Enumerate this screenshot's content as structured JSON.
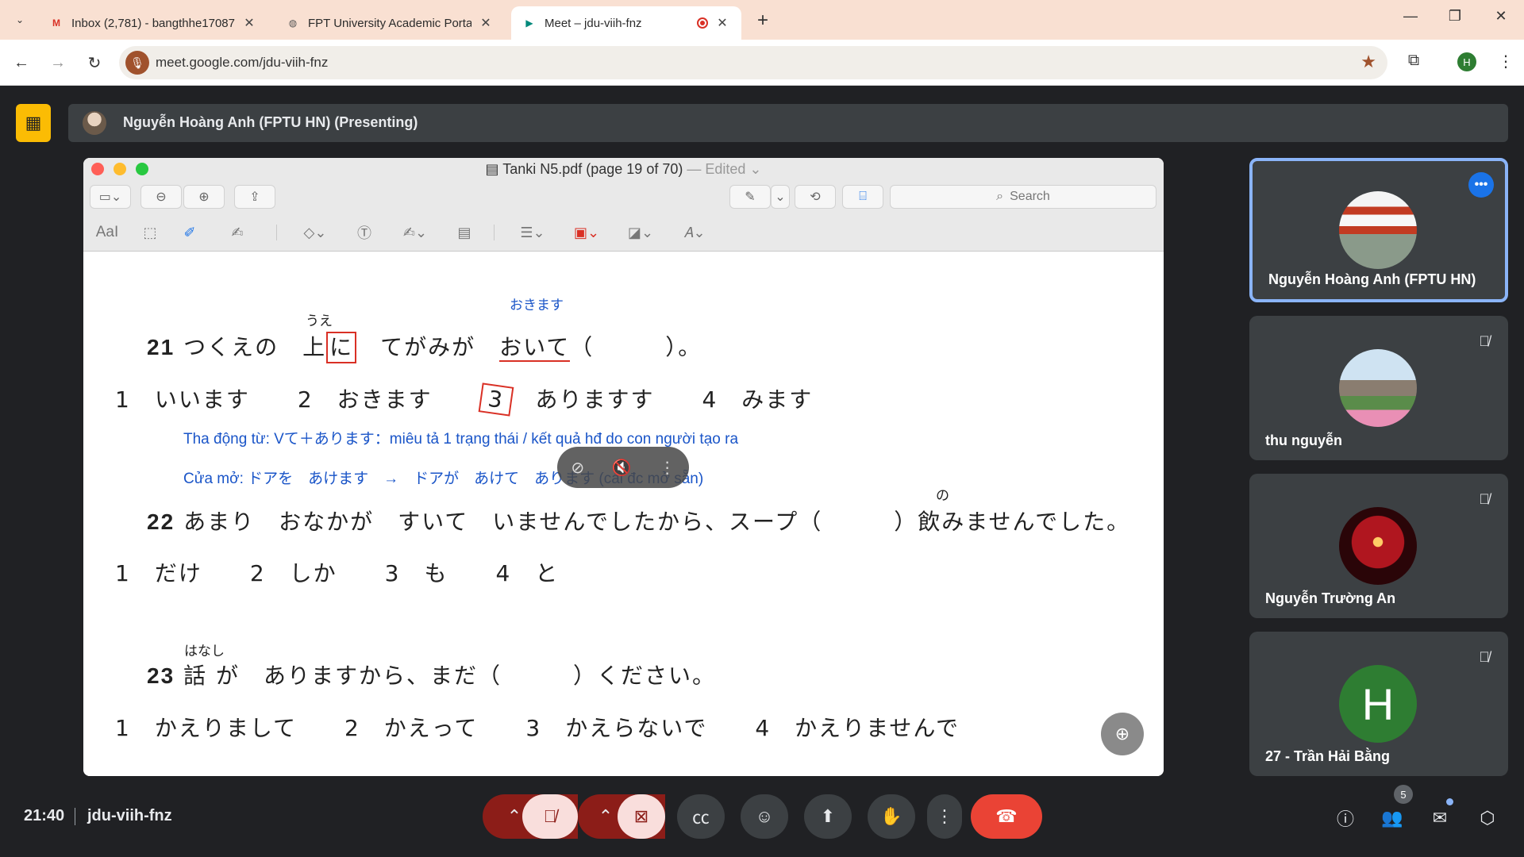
{
  "browser": {
    "tabs": [
      {
        "title": "Inbox (2,781) - bangthhe17087",
        "favicon": "gmail-icon",
        "favicon_color": "#d93025"
      },
      {
        "title": "FPT University Academic Portal",
        "favicon": "globe-icon",
        "favicon_color": "#555555"
      },
      {
        "title": "Meet – jdu-viih-fnz",
        "favicon": "meet-icon",
        "favicon_color": "#00897b"
      }
    ],
    "url": "meet.google.com/jdu-viih-fnz",
    "profile_initial": "H",
    "accent": "#f9e0d2"
  },
  "presenting": {
    "label": "Nguyễn Hoàng Anh (FPTU HN) (Presenting)"
  },
  "preview": {
    "title": "Tanki N5.pdf (page 19 of 70)",
    "edited": " — Edited ⌄",
    "search_placeholder": "Search",
    "tools": {
      "text": "AaI"
    }
  },
  "document": {
    "q21": {
      "num": "21",
      "text_a": "つくえの　",
      "kanji": "上",
      "boxed": "に",
      "text_b": "　てがみが　",
      "underlined": "おいて",
      "text_c": "（　　　）。",
      "furigana_ue": "うえ",
      "annotation": "おきます",
      "options": "1　いいます　　2　おきます　　",
      "opt3_num": "3",
      "options_rest": "ありますす　　4　みます"
    },
    "note1": "Tha động từ: Vて＋あります：miêu tả 1 trạng thái / kết quả hđ do con người tạo ra",
    "note2": "Cửa mở:  ドアを　あけます　→　ドアが　あけて　あります (cái đc mở sẵn)",
    "q22": {
      "num": "22",
      "text": "あまり　おなかが　すいて　いませんでしたから、スープ（　　　）飲みませんでした。",
      "furigana_no": "の",
      "options": "1　だけ　　2　しか　　3　も　　4　と"
    },
    "q23": {
      "num": "23",
      "text": "話 が　ありますから、まだ（　　　）ください。",
      "furigana": "はなし",
      "options": "1　かえりまして　　2　かえって　　3　かえらないで　　4　かえりませんで"
    }
  },
  "participants": [
    {
      "name": "Nguyễn Hoàng Anh (FPTU HN)",
      "active": true,
      "avatar": "torii-gate-photo"
    },
    {
      "name": "thu nguyễn",
      "muted": true,
      "avatar": "landscape-photo"
    },
    {
      "name": "Nguyễn Trường An",
      "muted": true,
      "avatar": "iron-man-photo"
    },
    {
      "name": "27 - Trần Hải Bằng",
      "muted": true,
      "avatar_letter": "H",
      "avatar_color": "#2e7d32"
    }
  ],
  "meeting": {
    "time": "21:40",
    "code": "jdu-viih-fnz",
    "participant_count": "5"
  }
}
